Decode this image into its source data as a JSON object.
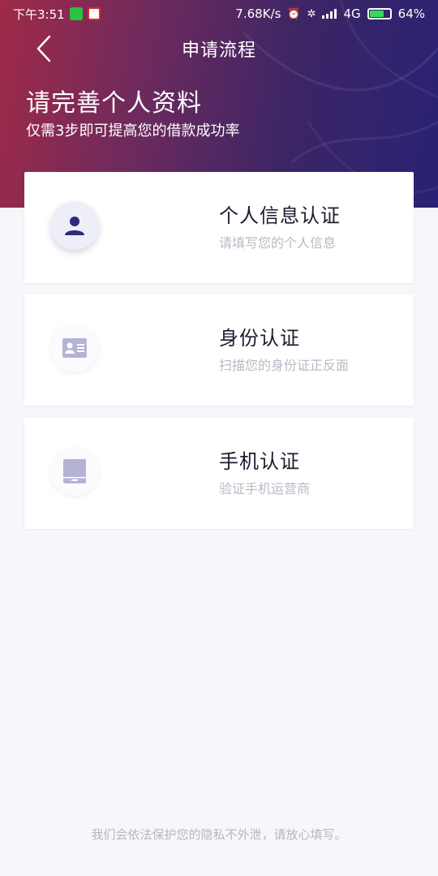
{
  "status_bar": {
    "time": "下午3:51",
    "network_speed": "7.68K/s",
    "network_type": "4G",
    "battery": "64%"
  },
  "nav": {
    "title": "申请流程",
    "back_icon": "chevron-left-icon"
  },
  "hero": {
    "headline": "请完善个人资料",
    "subline": "仅需3步即可提高您的借款成功率"
  },
  "steps": [
    {
      "title": "个人信息认证",
      "desc": "请填写您的个人信息",
      "icon": "person-icon",
      "active": true
    },
    {
      "title": "身份认证",
      "desc": "扫描您的身份证正反面",
      "icon": "id-card-icon",
      "active": false
    },
    {
      "title": "手机认证",
      "desc": "验证手机运营商",
      "icon": "phone-icon",
      "active": false
    }
  ],
  "footer": {
    "note": "我们会依法保护您的隐私不外泄，请放心填写。"
  },
  "colors": {
    "gradient_start": "#a02a48",
    "gradient_end": "#2a2275",
    "icon_active": "#2f2a7a",
    "icon_inactive": "#b4b3d6",
    "page_bg": "#f6f6fb"
  }
}
